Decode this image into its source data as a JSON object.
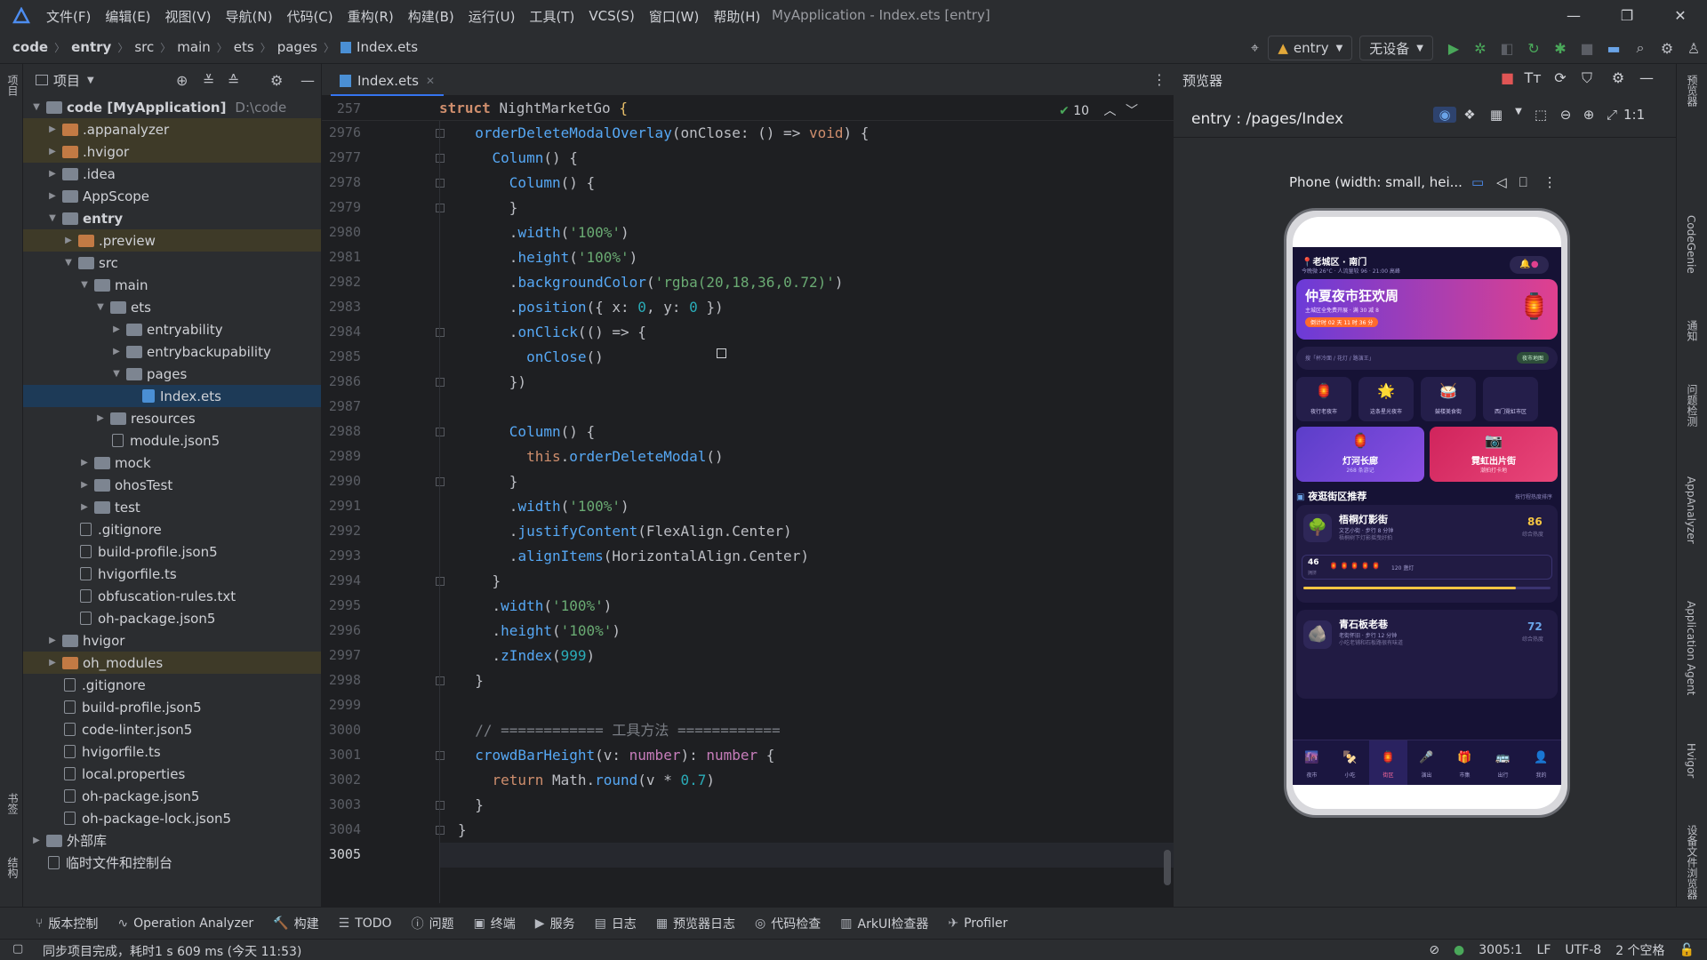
{
  "window": {
    "title": "MyApplication - Index.ets [entry]",
    "menu": [
      "文件(F)",
      "编辑(E)",
      "视图(V)",
      "导航(N)",
      "代码(C)",
      "重构(R)",
      "构建(B)",
      "运行(U)",
      "工具(T)",
      "VCS(S)",
      "窗口(W)",
      "帮助(H)"
    ]
  },
  "breadcrumb": [
    "code",
    "entry",
    "src",
    "main",
    "ets",
    "pages",
    "Index.ets"
  ],
  "toolbar": {
    "module": "entry",
    "device": "无设备"
  },
  "left_strip": {
    "project_label": "项目",
    "bookmarks_label": "书签",
    "structure_label": "结构"
  },
  "project": {
    "title": "项目",
    "tree": [
      {
        "label": "code [MyApplication]",
        "extra": "D:\\code",
        "depth": 0,
        "arrow": "down",
        "icon": "folder"
      },
      {
        "label": ".appanalyzer",
        "depth": 1,
        "arrow": "right",
        "icon": "ofolder",
        "hl": true
      },
      {
        "label": ".hvigor",
        "depth": 1,
        "arrow": "right",
        "icon": "ofolder",
        "hl": true
      },
      {
        "label": ".idea",
        "depth": 1,
        "arrow": "right",
        "icon": "folder"
      },
      {
        "label": "AppScope",
        "depth": 1,
        "arrow": "right",
        "icon": "folder"
      },
      {
        "label": "entry",
        "depth": 1,
        "arrow": "down",
        "icon": "folder",
        "bold": true
      },
      {
        "label": ".preview",
        "depth": 2,
        "arrow": "right",
        "icon": "ofolder",
        "hl": true
      },
      {
        "label": "src",
        "depth": 2,
        "arrow": "down",
        "icon": "folder"
      },
      {
        "label": "main",
        "depth": 3,
        "arrow": "down",
        "icon": "folder"
      },
      {
        "label": "ets",
        "depth": 4,
        "arrow": "down",
        "icon": "folder"
      },
      {
        "label": "entryability",
        "depth": 5,
        "arrow": "right",
        "icon": "folder"
      },
      {
        "label": "entrybackupability",
        "depth": 5,
        "arrow": "right",
        "icon": "folder"
      },
      {
        "label": "pages",
        "depth": 5,
        "arrow": "down",
        "icon": "folder"
      },
      {
        "label": "Index.ets",
        "depth": 6,
        "arrow": "",
        "icon": "ets",
        "sel": true
      },
      {
        "label": "resources",
        "depth": 4,
        "arrow": "right",
        "icon": "folder"
      },
      {
        "label": "module.json5",
        "depth": 4,
        "arrow": "",
        "icon": "file"
      },
      {
        "label": "mock",
        "depth": 3,
        "arrow": "right",
        "icon": "folder"
      },
      {
        "label": "ohosTest",
        "depth": 3,
        "arrow": "right",
        "icon": "folder"
      },
      {
        "label": "test",
        "depth": 3,
        "arrow": "right",
        "icon": "folder"
      },
      {
        "label": ".gitignore",
        "depth": 2,
        "arrow": "",
        "icon": "file"
      },
      {
        "label": "build-profile.json5",
        "depth": 2,
        "arrow": "",
        "icon": "file"
      },
      {
        "label": "hvigorfile.ts",
        "depth": 2,
        "arrow": "",
        "icon": "file"
      },
      {
        "label": "obfuscation-rules.txt",
        "depth": 2,
        "arrow": "",
        "icon": "file"
      },
      {
        "label": "oh-package.json5",
        "depth": 2,
        "arrow": "",
        "icon": "file"
      },
      {
        "label": "hvigor",
        "depth": 1,
        "arrow": "right",
        "icon": "folder"
      },
      {
        "label": "oh_modules",
        "depth": 1,
        "arrow": "right",
        "icon": "ofolder",
        "hl": true
      },
      {
        "label": ".gitignore",
        "depth": 1,
        "arrow": "",
        "icon": "file"
      },
      {
        "label": "build-profile.json5",
        "depth": 1,
        "arrow": "",
        "icon": "file"
      },
      {
        "label": "code-linter.json5",
        "depth": 1,
        "arrow": "",
        "icon": "file"
      },
      {
        "label": "hvigorfile.ts",
        "depth": 1,
        "arrow": "",
        "icon": "file"
      },
      {
        "label": "local.properties",
        "depth": 1,
        "arrow": "",
        "icon": "file"
      },
      {
        "label": "oh-package.json5",
        "depth": 1,
        "arrow": "",
        "icon": "file"
      },
      {
        "label": "oh-package-lock.json5",
        "depth": 1,
        "arrow": "",
        "icon": "file"
      },
      {
        "label": "外部库",
        "depth": 0,
        "arrow": "right",
        "icon": "folder"
      },
      {
        "label": "临时文件和控制台",
        "depth": 0,
        "arrow": "",
        "icon": "file"
      }
    ]
  },
  "editor": {
    "tab": "Index.ets",
    "sticky_line_no": "257",
    "sticky_text": "struct NightMarketGo {",
    "check_count": "10",
    "line_numbers": [
      "2976",
      "2977",
      "2978",
      "2979",
      "2980",
      "2981",
      "2982",
      "2983",
      "2984",
      "2985",
      "2986",
      "2987",
      "2988",
      "2989",
      "2990",
      "2991",
      "2992",
      "2993",
      "2994",
      "2995",
      "2996",
      "2997",
      "2998",
      "2999",
      "3000",
      "3001",
      "3002",
      "3003",
      "3004",
      "3005"
    ]
  },
  "previewer": {
    "panel_title": "预览器",
    "route": "entry : /pages/Index",
    "device_label": "Phone (width: small, hei...",
    "app": {
      "location": "老城区 · 南门",
      "weather": "今晚微 26°C · 人流量较 96 · 21:00 高峰",
      "banner_title": "仲夏夜市狂欢周",
      "banner_sub": "主城区全免费开展 · 满 30 减 8",
      "banner_countdown": "倒计时 02 天 11 时 36 分",
      "search_placeholder": "搜「杯冷面 / 花灯 / 路演王」",
      "search_btn": "夜市地图",
      "categories": [
        {
          "icon": "🏮",
          "label": "夜行老夜市"
        },
        {
          "icon": "🌟",
          "label": "这条星光夜市"
        },
        {
          "icon": "🥁",
          "label": "鼓楼美食街"
        },
        {
          "icon": "",
          "label": "西门霓虹市区"
        }
      ],
      "big_cards": [
        {
          "icon": "🏮",
          "title": "灯河长廊",
          "sub": "268 条游记"
        },
        {
          "icon": "📷",
          "title": "霓虹出片街",
          "sub": "潮拍打卡地"
        }
      ],
      "section_title": "夜逛街区推荐",
      "section_more": "按行程热度排序",
      "spots": [
        {
          "icon": "🌳",
          "name": "梧桐灯影街",
          "desc": "文艺小街 · 步行 8 分钟",
          "desc2": "梧桐树下灯影摇曳好拍",
          "score": "86",
          "score_sub": "综合热度",
          "crowd": "46",
          "crowd_sub": "拥挤",
          "lanterns": "🏮🏮🏮🏮🏮",
          "lantern_count": "120 盏灯"
        },
        {
          "icon": "🪨",
          "name": "青石板老巷",
          "desc": "老街怀旧 · 步行 12 分钟",
          "desc2": "小吃老铺和石板路很有味道",
          "score": "72",
          "score_sub": "综合热度"
        }
      ],
      "tabs": [
        {
          "icon": "🌆",
          "label": "夜市"
        },
        {
          "icon": "🍢",
          "label": "小吃"
        },
        {
          "icon": "🏮",
          "label": "街区"
        },
        {
          "icon": "🎤",
          "label": "演出"
        },
        {
          "icon": "🎁",
          "label": "市集"
        },
        {
          "icon": "🚌",
          "label": "出行"
        },
        {
          "icon": "👤",
          "label": "我的"
        }
      ]
    }
  },
  "right_strip": [
    "预览器",
    "CodeGenie",
    "通知",
    "问题检测",
    "AppAnalyzer",
    "Application Agent",
    "Hvigor",
    "设备文件浏览器"
  ],
  "bottom_tools": [
    {
      "icon": "⑂",
      "label": "版本控制"
    },
    {
      "icon": "∿",
      "label": "Operation Analyzer"
    },
    {
      "icon": "🔨",
      "label": "构建"
    },
    {
      "icon": "☰",
      "label": "TODO"
    },
    {
      "icon": "ⓘ",
      "label": "问题"
    },
    {
      "icon": "▣",
      "label": "终端"
    },
    {
      "icon": "▶",
      "label": "服务"
    },
    {
      "icon": "▤",
      "label": "日志"
    },
    {
      "icon": "▦",
      "label": "预览器日志"
    },
    {
      "icon": "◎",
      "label": "代码检查"
    },
    {
      "icon": "▥",
      "label": "ArkUI检查器"
    },
    {
      "icon": "✈",
      "label": "Profiler"
    }
  ],
  "status": {
    "message": "同步项目完成，耗时1 s 609 ms (今天 11:53)",
    "position": "3005:1",
    "line_sep": "LF",
    "encoding": "UTF-8",
    "indent": "2 个空格"
  },
  "colors": {
    "accent": "#3574f0",
    "banner_from": "#6b3bd8",
    "banner_to": "#e0408e",
    "app_bg": "#161235",
    "run_green": "#4aa85a"
  }
}
